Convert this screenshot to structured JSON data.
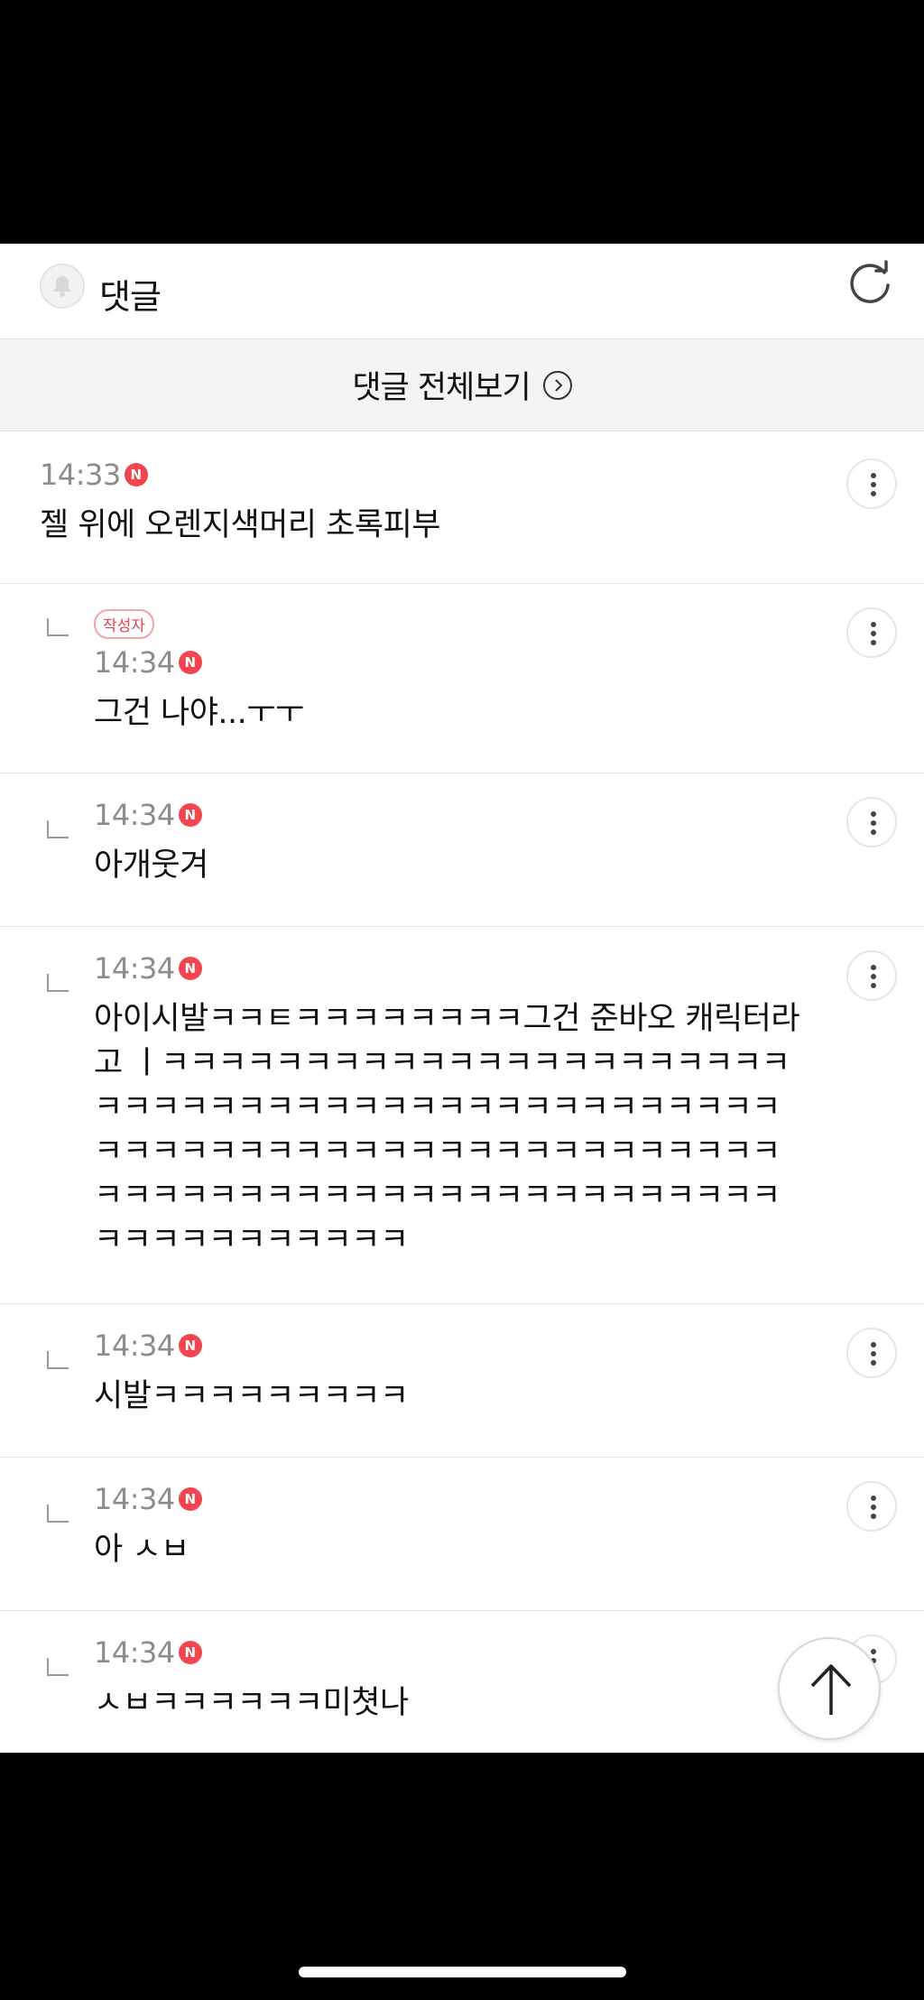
{
  "header": {
    "title": "댓글",
    "bell_icon": "bell-icon",
    "refresh_icon": "refresh-icon"
  },
  "view_all": {
    "label": "댓글 전체보기",
    "icon": "chevron-right-circle-icon"
  },
  "new_badge_text": "N",
  "comments": [
    {
      "reply": false,
      "author": "",
      "time": "14:33",
      "text": "젤 위에 오렌지색머리 초록피부"
    },
    {
      "reply": true,
      "author": "작성자",
      "time": "14:34",
      "text": "그건 나야...ㅜㅜ"
    },
    {
      "reply": true,
      "author": "",
      "time": "14:34",
      "text": "아개웃겨"
    },
    {
      "reply": true,
      "author": "",
      "time": "14:34",
      "text": "아이시발ㅋㅋㅌㅋㅋㅋㅋㅋㅋㅋㅋ그건 준바오 캐릭터라고 ㅣㅋㅋㅋㅋㅋㅋㅋㅋㅋㅋㅋㅋㅋㅋㅋㅋㅋㅋㅋㅋㅋㅋㅋㅋㅋㅋㅋㅋㅋㅋㅋㅋㅋㅋㅋㅋㅋㅋㅋㅋㅋㅋㅋㅋㅋㅋㅋㅋㅋㅋㅋㅋㅋㅋㅋㅋㅋㅋㅋㅋㅋㅋㅋㅋㅋㅋㅋㅋㅋㅋㅋㅋㅋㅋㅋㅋㅋㅋㅋㅋㅋㅋㅋㅋㅋㅋㅋㅋㅋㅋㅋㅋㅋㅋㅋㅋㅋㅋㅋㅋㅋㅋㅋㅋㅋ"
    },
    {
      "reply": true,
      "author": "",
      "time": "14:34",
      "text": "시발ㅋㅋㅋㅋㅋㅋㅋㅋㅋ"
    },
    {
      "reply": true,
      "author": "",
      "time": "14:34",
      "text": "아 ㅅㅂ"
    },
    {
      "reply": true,
      "author": "",
      "time": "14:34",
      "text": "ㅅㅂㅋㅋㅋㅋㅋㅋ미쳣나"
    }
  ],
  "scroll_top_icon": "arrow-up-icon"
}
